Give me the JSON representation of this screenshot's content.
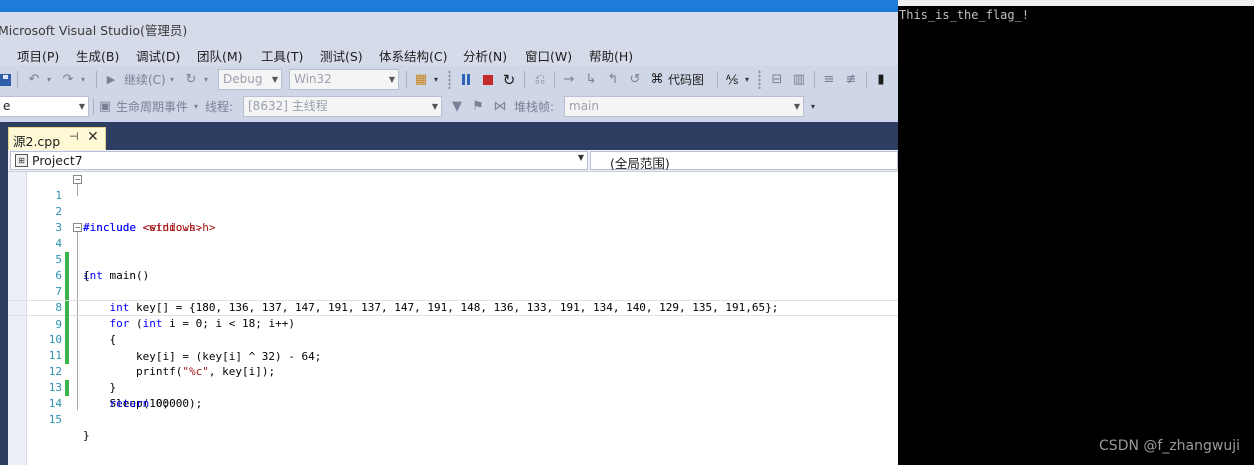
{
  "window": {
    "title": "Microsoft Visual Studio(管理员)"
  },
  "menu": [
    "项目(P)",
    "生成(B)",
    "调试(D)",
    "团队(M)",
    "工具(T)",
    "测试(S)",
    "体系结构(C)",
    "分析(N)",
    "窗口(W)",
    "帮助(H)"
  ],
  "toolbar1": {
    "continue_label": "继续(C)",
    "config": "Debug",
    "platform": "Win32",
    "codemap_label": "代码图"
  },
  "toolbar2": {
    "left_combo": "e",
    "lifecycle_label": "生命周期事件",
    "thread_label": "线程:",
    "thread_value": "[8632] 主线程",
    "stackframe_label": "堆栈帧:",
    "stackframe_value": "main"
  },
  "tab": {
    "name": "源2.cpp",
    "pin": "⊣",
    "close": "✕"
  },
  "navbar": {
    "project": "Project7",
    "scope": "(全局范围)"
  },
  "code_lines": [
    {
      "n": "1",
      "text": "#include <stdio.h>"
    },
    {
      "n": "2",
      "text": "#include <windows.h>"
    },
    {
      "n": "3",
      "text": ""
    },
    {
      "n": "4",
      "text": "int main()"
    },
    {
      "n": "5",
      "text": "{"
    },
    {
      "n": "6",
      "text": "    int key[] = {180, 136, 137, 147, 191, 137, 147, 191, 148, 136, 133, 191, 134, 140, 129, 135, 191,65};"
    },
    {
      "n": "7",
      "text": "    for (int i = 0; i < 18; i++)"
    },
    {
      "n": "8",
      "text": "    {"
    },
    {
      "n": "9",
      "text": "        key[i] = (key[i] ^ 32) - 64;"
    },
    {
      "n": "10",
      "text": "        printf(\"%c\", key[i]);"
    },
    {
      "n": "11",
      "text": "    }"
    },
    {
      "n": "12",
      "text": "    Sleep(100000);"
    },
    {
      "n": "13",
      "text": "    return 0;"
    },
    {
      "n": "14",
      "text": ""
    },
    {
      "n": "15",
      "text": "}"
    }
  ],
  "console": {
    "output": "This_is_the_flag_!"
  },
  "watermark": "CSDN @f_zhangwuji"
}
